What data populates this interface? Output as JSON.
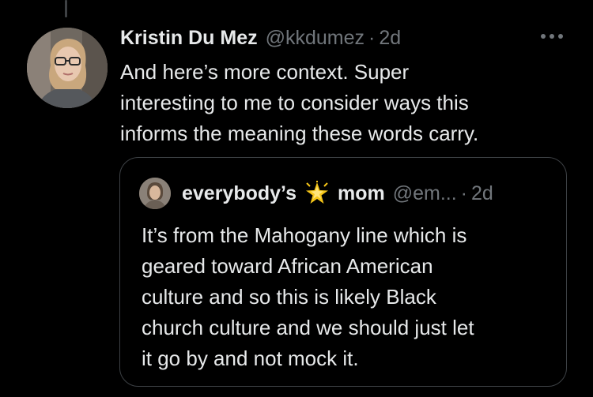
{
  "tweet": {
    "author_name": "Kristin Du Mez",
    "author_handle": "@kkdumez",
    "separator": "·",
    "time": "2d",
    "text": "And here’s more context. Super\ninteresting to me to consider ways this\ninforms the meaning these words carry.",
    "avatar_icon": "profile-photo"
  },
  "quoted_tweet": {
    "name_part1": "everybody’s",
    "name_emoji": "sparkle-star-emoji",
    "name_part2": "mom",
    "handle": "@em...",
    "separator": "·",
    "time": "2d",
    "text": "It’s from the Mahogany line which is\ngeared toward African American\nculture and so this is likely Black\nchurch culture and we should just let\nit go by and not mock it."
  },
  "colors": {
    "background": "#000000",
    "text_primary": "#e7e9ea",
    "text_secondary": "#71767b",
    "border": "#3d4145",
    "emoji_star": "#f5c518"
  }
}
